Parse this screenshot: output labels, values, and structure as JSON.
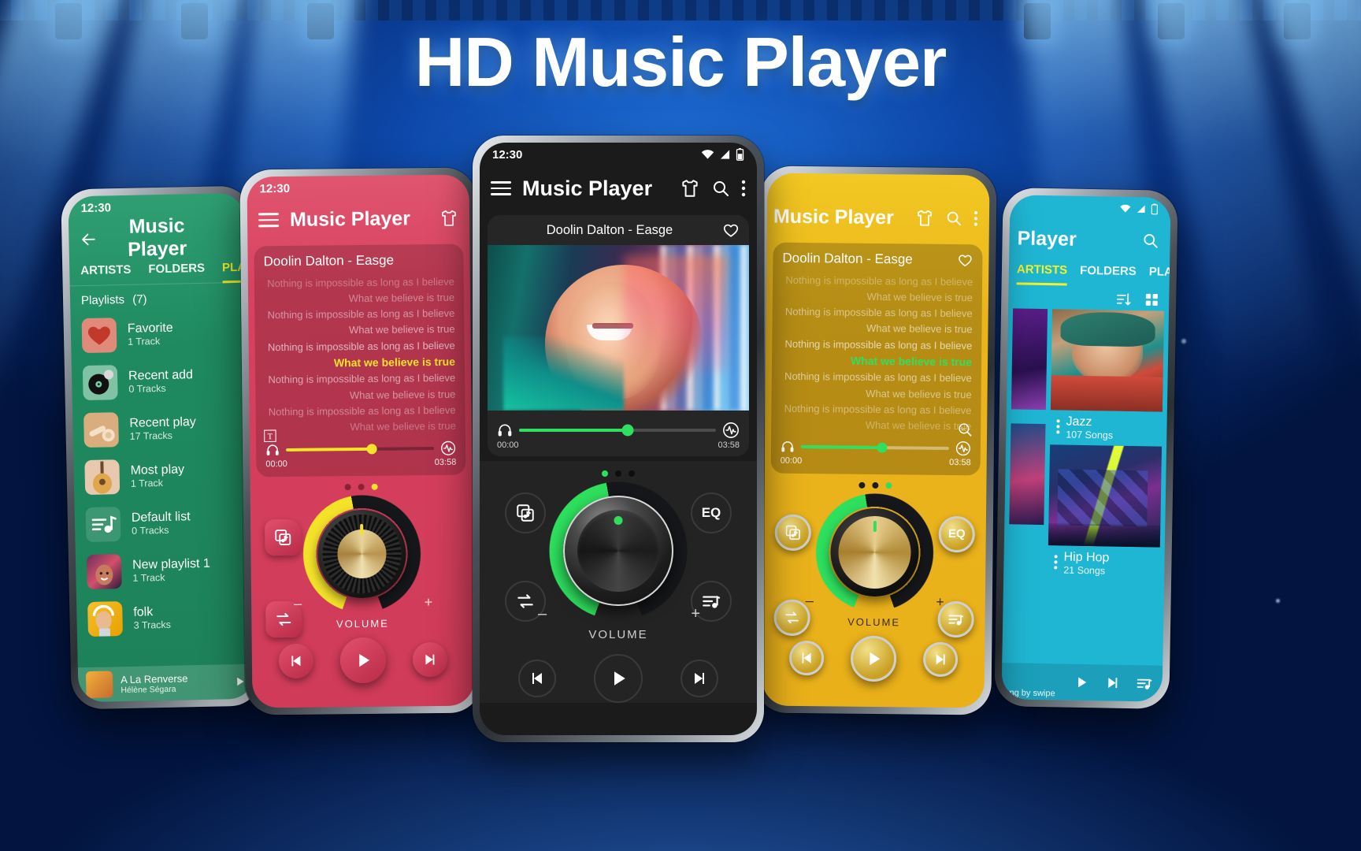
{
  "hero": {
    "title": "HD Music Player"
  },
  "colors": {
    "green": "#1f8a5f",
    "pink": "#d8415f",
    "black": "#1b1b1b",
    "gold": "#f0c020",
    "cyan": "#1fb6d4",
    "accent_yellow": "#f5f02a",
    "accent_green": "#2ee05e",
    "gold_knob": "#d9b45a",
    "background": "#062a70"
  },
  "common": {
    "status_time": "12:30",
    "app_title": "Music Player",
    "song_title": "Doolin Dalton - Easge",
    "time_start": "00:00",
    "time_end": "03:58",
    "volume_label": "VOLUME",
    "eq_label": "EQ",
    "lyrics": [
      "Nothing is impossible as long as I believe",
      "What we believe is true",
      "Nothing is impossible as long as I believe",
      "What we believe is true",
      "Nothing is impossible as long as I believe",
      "What we believe is true",
      "Nothing is impossible as long as I believe",
      "What we believe is true",
      "Nothing is impossible as long as I believe",
      "What we believe is true"
    ],
    "highlight_lyric_index": 5,
    "icons": {
      "menu": "hamburger-icon",
      "shirt": "theme-shirt-icon",
      "search": "search-icon",
      "overflow": "overflow-menu-icon",
      "back": "back-arrow-icon",
      "heart": "favorite-heart-icon",
      "headphone": "headphone-icon",
      "equalizer_wave": "equalizer-wave-icon",
      "lyric_search": "lyric-search-icon",
      "text": "text-format-icon",
      "playlist": "playlist-icon",
      "repeat": "repeat-icon",
      "queue": "queue-music-icon",
      "prev": "previous-track-icon",
      "play": "play-icon",
      "next": "next-track-icon",
      "sort": "sort-icon",
      "gridview": "grid-view-icon",
      "wifi": "wifi-icon",
      "signal": "signal-icon",
      "battery": "battery-icon"
    }
  },
  "phone_green": {
    "status_time": "12:30",
    "app_title": "Music Player",
    "tabs": [
      {
        "label": "ARTISTS",
        "active": false
      },
      {
        "label": "FOLDERS",
        "active": false
      },
      {
        "label": "PLAYLISTS",
        "active": true
      }
    ],
    "section_header": "Playlists",
    "section_count": "(7)",
    "playlists": [
      {
        "title": "Favorite",
        "subtitle": "1 Track",
        "art": "heart"
      },
      {
        "title": "Recent add",
        "subtitle": "0 Tracks",
        "art": "vinyl"
      },
      {
        "title": "Recent play",
        "subtitle": "17 Tracks",
        "art": "brush"
      },
      {
        "title": "Most play",
        "subtitle": "1 Track",
        "art": "guitar"
      },
      {
        "title": "Default list",
        "subtitle": "0 Tracks",
        "art": "note"
      },
      {
        "title": "New playlist 1",
        "subtitle": "1 Track",
        "art": "girl-neon"
      },
      {
        "title": "folk",
        "subtitle": "3 Tracks",
        "art": "girl-yellow"
      }
    ],
    "now_playing": {
      "title": "A La Renverse",
      "artist": "Hélène Ségara"
    }
  },
  "phone_pink": {
    "status_time": "12:30",
    "app_title": "Music Player",
    "song_title": "Doolin Dalton - Easge",
    "time_start": "00:00",
    "time_end": "03:58",
    "volume_label": "VOLUME",
    "dot_index": 2
  },
  "phone_black": {
    "status_time": "12:30",
    "app_title": "Music Player",
    "song_title": "Doolin Dalton - Easge",
    "time_start": "00:00",
    "time_end": "03:58",
    "volume_label": "VOLUME",
    "eq_label": "EQ",
    "dot_index": 0
  },
  "phone_gold": {
    "status_time": "12:30",
    "app_title": "Music Player",
    "song_title": "Doolin Dalton - Easge",
    "time_start": "00:00",
    "time_end": "03:58",
    "volume_label": "VOLUME",
    "eq_label": "EQ",
    "dot_index": 2
  },
  "phone_cyan": {
    "app_title": "Player",
    "tabs": [
      {
        "label": "ARTISTS",
        "active": true
      },
      {
        "label": "FOLDERS",
        "active": false
      },
      {
        "label": "PLAYLISTS",
        "active": false
      }
    ],
    "cards": [
      {
        "title": "Jazz",
        "subtitle": "107 Songs"
      },
      {
        "title": "Hip Hop",
        "subtitle": "21 Songs"
      }
    ],
    "footer_hint": "ng by swipe"
  }
}
